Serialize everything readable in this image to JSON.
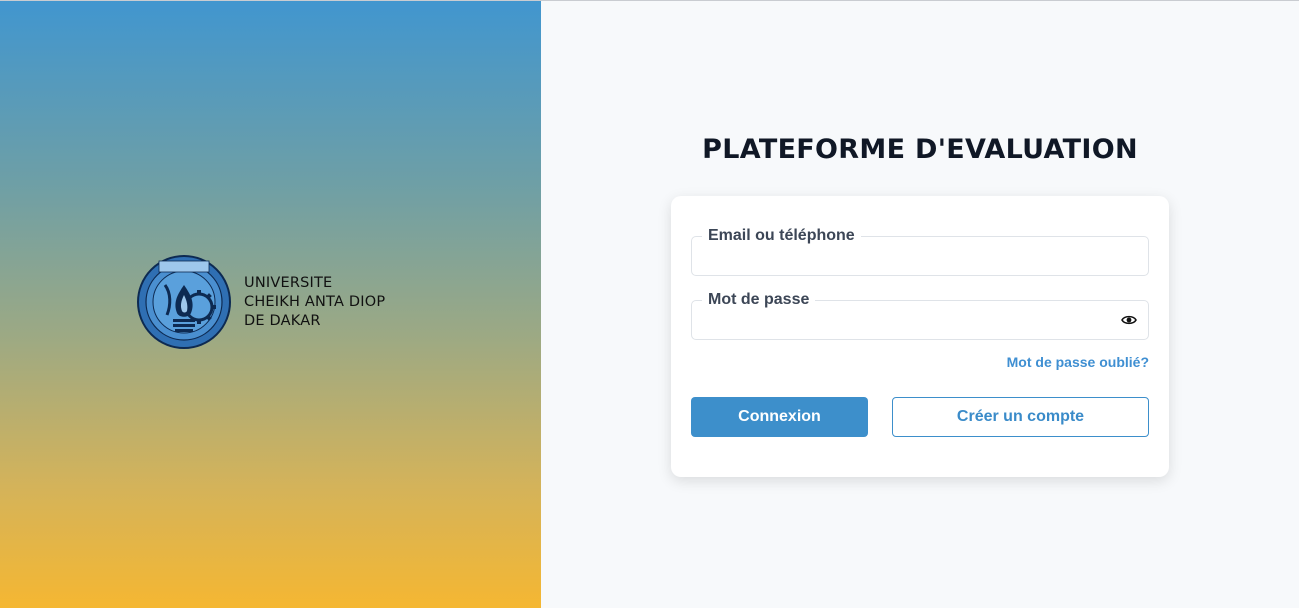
{
  "branding": {
    "logo_text": "LUX MEA LEX",
    "university_line1": "UNIVERSITE",
    "university_line2": "CHEIKH ANTA DIOP",
    "university_line3": "DE DAKAR"
  },
  "login": {
    "title": "PLATEFORME D'EVALUATION",
    "email_label": "Email ou téléphone",
    "email_value": "",
    "password_label": "Mot de passe",
    "password_value": "",
    "forgot_link": "Mot de passe oublié?",
    "login_button": "Connexion",
    "create_button": "Créer un compte"
  },
  "icons": {
    "password_toggle": "eye-icon"
  },
  "colors": {
    "primary": "#3d8fcb",
    "gradient_top": "#4196cf",
    "gradient_bottom": "#f5b732"
  }
}
